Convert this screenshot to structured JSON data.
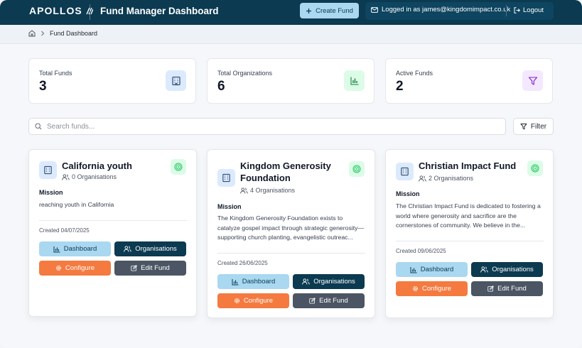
{
  "header": {
    "logo": "APOLLOS",
    "title": "Fund Manager Dashboard",
    "create_label": "Create Fund",
    "user_label": "Logged in as james@kingdomimpact.co.uk",
    "logout_label": "Logout"
  },
  "breadcrumb": {
    "current": "Fund Dashboard"
  },
  "stats": [
    {
      "label": "Total Funds",
      "value": "3",
      "icon": "building-icon",
      "color": "#dbeafe"
    },
    {
      "label": "Total Organizations",
      "value": "6",
      "icon": "bar-chart-icon",
      "color": "#dcfce7"
    },
    {
      "label": "Active Funds",
      "value": "2",
      "icon": "filter-icon",
      "color": "#f3e8ff"
    }
  ],
  "search": {
    "placeholder": "Search funds...",
    "filter_label": "Filter"
  },
  "funds": [
    {
      "name": "California youth",
      "orgs": "0 Organisations",
      "mission_label": "Mission",
      "mission": "reaching youth in California",
      "created": "Created 04/07/2025"
    },
    {
      "name": "Kingdom Generosity Foundation",
      "orgs": "4 Organisations",
      "mission_label": "Mission",
      "mission": "The Kingdom Generosity Foundation exists to catalyze gospel impact through strategic generosity—supporting church planting, evangelistic outreac...",
      "created": "Created 26/06/2025"
    },
    {
      "name": "Christian Impact Fund",
      "orgs": "2 Organisations",
      "mission_label": "Mission",
      "mission": "The Christian Impact Fund is dedicated to fostering a world where generosity and sacrifice are the cornerstones of community. We believe in the...",
      "created": "Created 09/06/2025"
    }
  ],
  "card_buttons": {
    "dashboard": "Dashboard",
    "organisations": "Organisations",
    "configure": "Configure",
    "edit": "Edit Fund"
  },
  "colors": {
    "primary": "#0b3a51",
    "accent_light": "#a9d8f0",
    "configure": "#f47a3f",
    "edit": "#4b5563"
  }
}
